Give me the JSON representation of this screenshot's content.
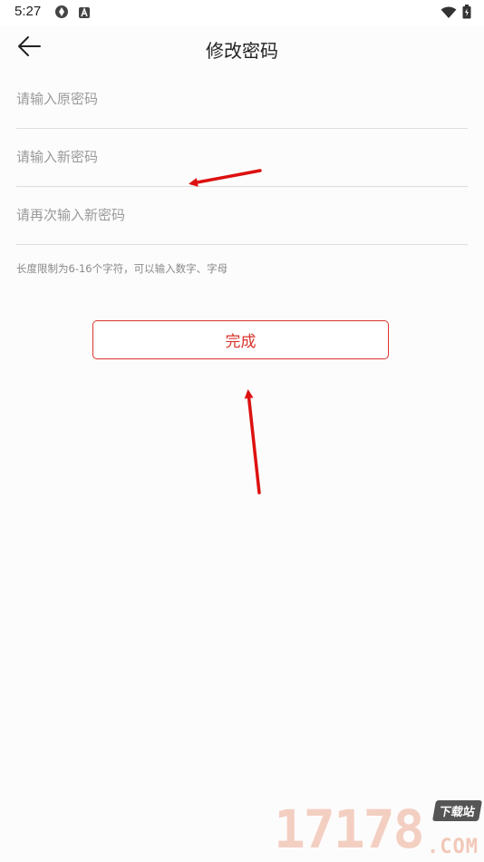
{
  "status_bar": {
    "time": "5:27",
    "left_icons": [
      "sync-icon",
      "a-badge-icon"
    ],
    "right_icons": [
      "wifi-icon",
      "battery-icon"
    ]
  },
  "header": {
    "title": "修改密码",
    "back_icon": "back-arrow-icon"
  },
  "form": {
    "old_password_placeholder": "请输入原密码",
    "new_password_placeholder": "请输入新密码",
    "confirm_password_placeholder": "请再次输入新密码",
    "hint": "长度限制为6-16个字符，可以输入数字、字母",
    "submit_label": "完成"
  },
  "watermark": {
    "number": "17178",
    "tag": "下载站",
    "domain": ".COM"
  },
  "colors": {
    "accent": "#d8332b",
    "annotation_arrow": "#dd1111"
  }
}
